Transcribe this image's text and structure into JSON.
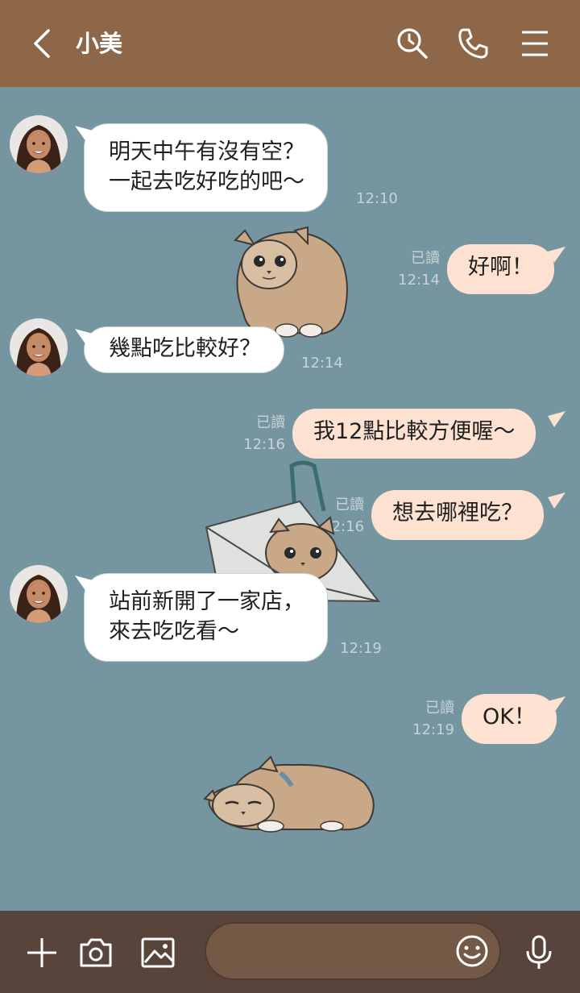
{
  "header": {
    "contact_name": "小美",
    "icons": [
      "back-chevron-icon",
      "search-icon",
      "phone-icon",
      "menu-icon"
    ]
  },
  "messages": [
    {
      "from": "other",
      "lines": [
        "明天中午有沒有空？",
        "一起去吃好吃的吧～"
      ],
      "time": "12:10"
    },
    {
      "from": "other",
      "sticker": "cat-sticker-sitting"
    },
    {
      "from": "me",
      "lines": [
        "好啊！"
      ],
      "read": "已讀",
      "time": "12:14"
    },
    {
      "from": "other",
      "lines": [
        "幾點吃比較好？"
      ],
      "time": "12:14"
    },
    {
      "from": "me",
      "lines": [
        "我12點比較方便喔～"
      ],
      "read": "已讀",
      "time": "12:16"
    },
    {
      "from": "other",
      "sticker": "cat-sticker-in-bag"
    },
    {
      "from": "me",
      "lines": [
        "想去哪裡吃？"
      ],
      "read": "已讀",
      "time": "12:16"
    },
    {
      "from": "other",
      "lines": [
        "站前新開了一家店，",
        "來去吃吃看～"
      ],
      "time": "12:19"
    },
    {
      "from": "me",
      "lines": [
        "OK！"
      ],
      "read": "已讀",
      "time": "12:19"
    },
    {
      "from": "other",
      "sticker": "cat-sticker-lying"
    }
  ],
  "footer": {
    "icons": [
      "plus-icon",
      "camera-icon",
      "image-icon",
      "emoji-icon",
      "microphone-icon"
    ],
    "input_value": ""
  },
  "colors": {
    "header": "#8d6747",
    "chat_background": "#7596a0",
    "incoming_bubble": "#ffffff",
    "outgoing_bubble": "#fde2d1",
    "footer": "#58443a",
    "input": "#745946"
  }
}
